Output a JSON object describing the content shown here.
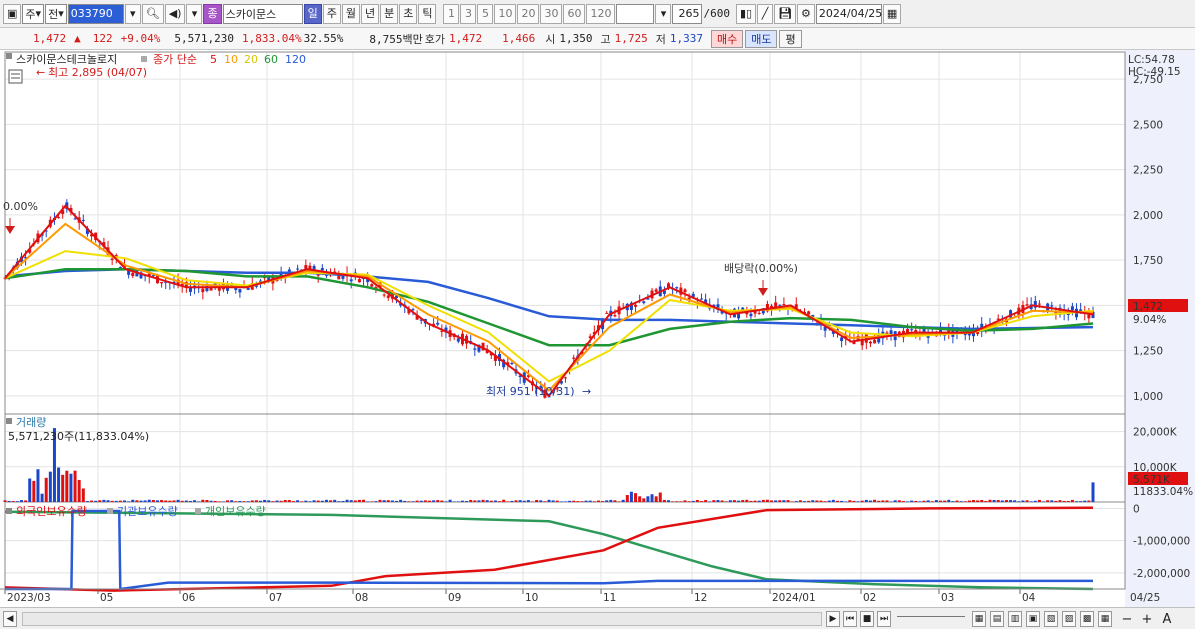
{
  "toolbar": {
    "period": "주",
    "compare": "전",
    "code": "033790",
    "stock_badge": "종",
    "stock_name": "스카이문스",
    "periods": [
      "일",
      "주",
      "월",
      "년",
      "분",
      "초",
      "틱"
    ],
    "active_period": "일",
    "intervals": [
      "1",
      "3",
      "5",
      "10",
      "20",
      "30",
      "60",
      "120"
    ],
    "count": "265",
    "count_max": "/600",
    "date": "2024/04/25"
  },
  "quote": {
    "price": "1,472",
    "change_arrow": "▲",
    "change": "122",
    "change_pct": "+9.04%",
    "volume": "5,571,230",
    "vol_pct": "1,833.04%",
    "turnover": "32.55%",
    "amount": "8,755백만",
    "hoga_label": "호가",
    "ask": "1,472",
    "bid": "1,466",
    "open_label": "시",
    "open": "1,350",
    "high_label": "고",
    "high": "1,725",
    "low_label": "저",
    "low": "1,337",
    "buy_label": "매수",
    "sell_label": "매도",
    "avg_label": "평"
  },
  "price_panel": {
    "title": "스카이문스테크놀로지",
    "legend_label": "종가 단순",
    "ma_labels": [
      "5",
      "10",
      "20",
      "60",
      "120"
    ],
    "high_annot": "최고 2,895 (04/07)",
    "low_annot": "최저 951 (10/31)",
    "div_annot": "배당락(0.00%)",
    "left_pct": "0.00%",
    "lc": "LC:54.78",
    "hc": "HC:-49.15",
    "last_price": "1,472",
    "last_pct": "9.04%",
    "yticks": [
      "2,750",
      "2,500",
      "2,250",
      "2,000",
      "1,750",
      "1,500",
      "1,250",
      "1,000"
    ]
  },
  "volume_panel": {
    "title": "거래량",
    "value_text": "5,571,230주(11,833.04%)",
    "yticks": [
      "20,000K",
      "10,000K"
    ],
    "last": "5,571K",
    "last_pct": "11833.04%"
  },
  "holding_panel": {
    "legends": [
      "외국인보유수량",
      "기관보유수량",
      "개인보유수량"
    ],
    "yticks": [
      "0",
      "-1,000,000",
      "-2,000,000"
    ]
  },
  "xaxis": {
    "labels": [
      "2023/03",
      "05",
      "06",
      "07",
      "08",
      "09",
      "10",
      "11",
      "12",
      "2024/01",
      "02",
      "03",
      "04"
    ],
    "right_label": "04/25"
  },
  "colors": {
    "ma5": "#e01010",
    "ma10": "#ff9900",
    "ma20": "#f0e000",
    "ma60": "#1e9632",
    "ma120": "#2a5bd7",
    "up": "#e01010",
    "down": "#1b46c8",
    "foreign": "#e01010",
    "institution": "#2a5bd7",
    "individual": "#2e9a5a"
  },
  "chart_data": {
    "type": "line",
    "title": "스카이문스테크놀로지",
    "x": [
      "2023/03",
      "05",
      "06",
      "07",
      "08",
      "09",
      "10",
      "11",
      "12",
      "2024/01",
      "02",
      "03",
      "04",
      "04/25"
    ],
    "ylim": [
      900,
      2900
    ],
    "series": [
      {
        "name": "5",
        "values": [
          1650,
          2050,
          1700,
          1600,
          1600,
          1700,
          1650,
          1400,
          1250,
          1000,
          1450,
          1600,
          1450,
          1500,
          1300,
          1350,
          1350,
          1500,
          1450
        ]
      },
      {
        "name": "10",
        "values": [
          1650,
          1950,
          1720,
          1620,
          1600,
          1690,
          1660,
          1450,
          1300,
          1030,
          1380,
          1560,
          1460,
          1490,
          1320,
          1340,
          1350,
          1470,
          1460
        ]
      },
      {
        "name": "20",
        "values": [
          1650,
          1800,
          1760,
          1640,
          1610,
          1680,
          1670,
          1500,
          1350,
          1080,
          1250,
          1530,
          1470,
          1480,
          1350,
          1330,
          1350,
          1440,
          1470
        ]
      },
      {
        "name": "60",
        "values": [
          1650,
          1700,
          1700,
          1690,
          1660,
          1660,
          1600,
          1520,
          1400,
          1280,
          1280,
          1370,
          1410,
          1430,
          1420,
          1380,
          1360,
          1370,
          1400
        ]
      },
      {
        "name": "120",
        "values": [
          1660,
          1690,
          1700,
          1690,
          1680,
          1680,
          1660,
          1630,
          1540,
          1440,
          1420,
          1420,
          1410,
          1400,
          1390,
          1380,
          1370,
          1375,
          1380
        ]
      }
    ],
    "volume": {
      "ylim": [
        0,
        25000
      ],
      "unit": "K",
      "last": 5571
    },
    "holdings": {
      "ylim": [
        -2500000,
        200000
      ],
      "series": [
        "외국인보유수량",
        "기관보유수량",
        "개인보유수량"
      ]
    }
  }
}
